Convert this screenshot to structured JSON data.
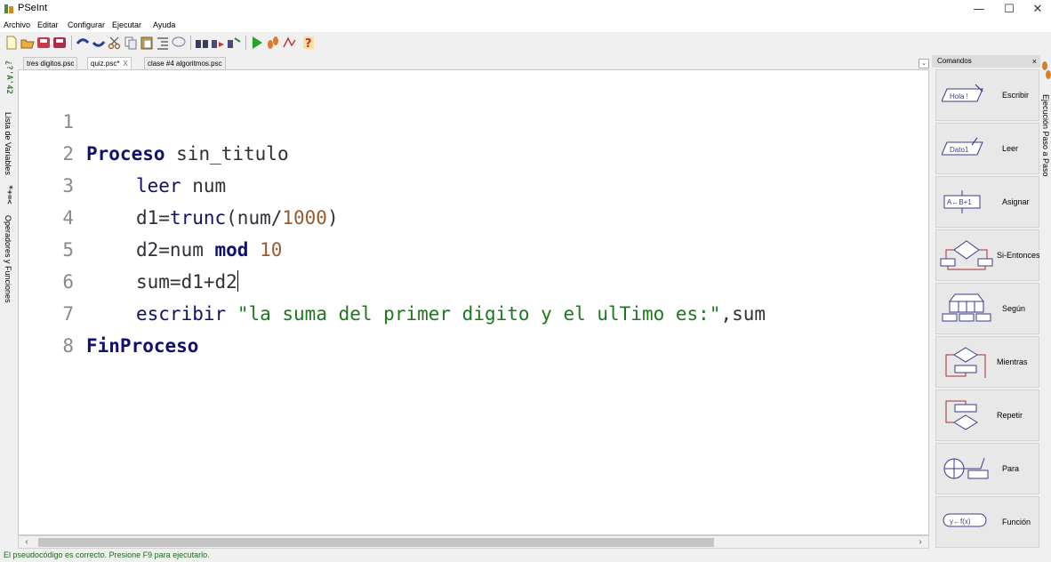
{
  "window": {
    "title": "PSeInt",
    "minimize": "—",
    "maximize": "☐",
    "close": "✕"
  },
  "menu": [
    "Archivo",
    "Editar",
    "Configurar",
    "Ejecutar",
    "Ayuda"
  ],
  "left_panel": {
    "variables_tab": "Lista de Variables",
    "operators_tab": "Operadores y Funciones",
    "icon_vars": "*+=<",
    "icon_ops": "¿?'A'42"
  },
  "tabs": [
    {
      "label": "tres digitos.psc",
      "close": ""
    },
    {
      "label": "quiz.psc*",
      "close": "X"
    },
    {
      "label": "clase #4 algoritmos.psc",
      "close": ""
    }
  ],
  "editor": {
    "line_numbers": [
      "1",
      "2",
      "3",
      "4",
      "5",
      "6",
      "7",
      "8"
    ],
    "code": {
      "l1_kw": "Proceso",
      "l1_name": " sin_titulo",
      "l2_kw": "leer",
      "l2_var": " num",
      "l3_a": "d1=",
      "l3_fn": "trunc",
      "l3_b": "(num/",
      "l3_num": "1000",
      "l3_c": ")",
      "l4_a": "d2=num ",
      "l4_kw": "mod",
      "l4_sp": " ",
      "l4_num": "10",
      "l5_a": "sum=d1+d2",
      "l6_kw": "escribir",
      "l6_sp": " ",
      "l6_str": "\"la suma del primer digito y el ulTimo es:\"",
      "l6_b": ",sum",
      "l7_kw": "FinProceso"
    }
  },
  "commands": {
    "header": "Comandos",
    "close": "×",
    "items": [
      {
        "label": "Escribir",
        "shape": "Hola !"
      },
      {
        "label": "Leer",
        "shape": "Dato1"
      },
      {
        "label": "Asignar",
        "shape": "A←B+1"
      },
      {
        "label": "Si-Entonces",
        "shape": ""
      },
      {
        "label": "Según",
        "shape": ""
      },
      {
        "label": "Mientras",
        "shape": ""
      },
      {
        "label": "Repetir",
        "shape": ""
      },
      {
        "label": "Para",
        "shape": ""
      },
      {
        "label": "Función",
        "shape": "y←f(x)"
      }
    ]
  },
  "right_panel": {
    "tab": "Ejecución Paso a Paso"
  },
  "status": {
    "message": "El pseudocódigo es correcto. Presione F9 para ejecutarlo."
  },
  "colors": {
    "keyword": "#101070",
    "number": "#9a5a2a",
    "string": "#1a7a1a",
    "status": "#1a6a1a"
  }
}
